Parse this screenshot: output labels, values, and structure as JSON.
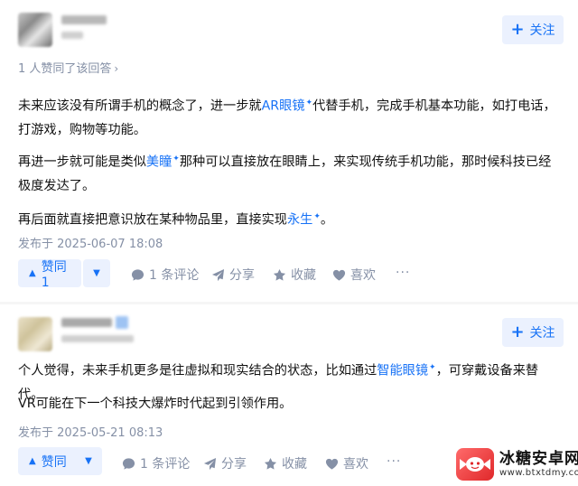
{
  "answers": [
    {
      "follow_label": "关注",
      "vote_meta": "1 人赞同了该回答",
      "paragraphs": [
        {
          "parts": [
            {
              "t": "未来应该没有所谓手机的概念了，进一步就"
            },
            {
              "t": "AR眼镜",
              "link": true
            },
            {
              "t": "代替手机，完成手机基本功能，如打电话，打游戏，购物等功能。"
            }
          ]
        },
        {
          "parts": [
            {
              "t": "再进一步就可能是类似"
            },
            {
              "t": "美瞳",
              "link": true
            },
            {
              "t": "那种可以直接放在眼睛上，来实现传统手机功能，那时候科技已经极度发达了。"
            }
          ]
        },
        {
          "parts": [
            {
              "t": "再后面就直接把意识放在某种物品里，直接实现"
            },
            {
              "t": "永生",
              "link": true
            },
            {
              "t": "。"
            }
          ]
        }
      ],
      "date": "发布于 2025-06-07 18:08",
      "upvote_label": "赞同 1",
      "comment_label": "1 条评论",
      "share_label": "分享",
      "collect_label": "收藏",
      "like_label": "喜欢",
      "more_label": "···"
    },
    {
      "follow_label": "关注",
      "paragraphs": [
        {
          "parts": [
            {
              "t": "个人觉得，未来手机更多是往虚拟和现实结合的状态，比如通过"
            },
            {
              "t": "智能眼镜",
              "link": true
            },
            {
              "t": "，可穿戴设备来替代。"
            }
          ]
        },
        {
          "parts": [
            {
              "t": "VR可能在下一个科技大爆炸时代起到引领作用。"
            }
          ]
        }
      ],
      "date": "发布于 2025-05-21 08:13",
      "upvote_label": "赞同",
      "comment_label": "1 条评论",
      "share_label": "分享",
      "collect_label": "收藏",
      "like_label": "喜欢",
      "more_label": "···"
    }
  ],
  "watermark": {
    "name": "冰糖安卓网",
    "url": "www.btxtdmy.com"
  },
  "colors": {
    "accent": "#1772f6",
    "accent_bg": "#ebf1fe",
    "meta": "#8590a6",
    "logo_red": "#e0282a"
  }
}
